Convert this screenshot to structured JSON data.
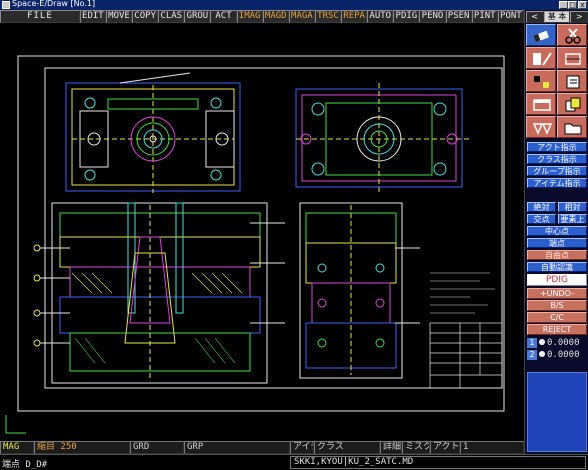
{
  "window": {
    "title": "Space-E/Draw [No.1]",
    "minimize": "_",
    "maximize": "□",
    "close": "x"
  },
  "menu": {
    "file": "FILE",
    "items": [
      {
        "label": "EDIT",
        "highlight": false
      },
      {
        "label": "MOVE",
        "highlight": false
      },
      {
        "label": "COPY",
        "highlight": false
      },
      {
        "label": "CLAS",
        "highlight": false
      },
      {
        "label": "GROU",
        "highlight": false
      },
      {
        "label": "ACT",
        "highlight": false
      },
      {
        "label": "IMAG",
        "highlight": true
      },
      {
        "label": "MAGD",
        "highlight": true
      },
      {
        "label": "MAGA",
        "highlight": true
      },
      {
        "label": "TRSC",
        "highlight": true
      },
      {
        "label": "REPA",
        "highlight": true
      },
      {
        "label": "AUTO",
        "highlight": false
      },
      {
        "label": "PDIG",
        "highlight": false
      },
      {
        "label": "PENO",
        "highlight": false
      },
      {
        "label": "PSEN",
        "highlight": false
      },
      {
        "label": "PINT",
        "highlight": false
      },
      {
        "label": "PONT",
        "highlight": false
      }
    ]
  },
  "panel": {
    "nav_prev": "<",
    "nav_label": "基 本",
    "nav_next": ">",
    "tools": [
      {
        "name": "eraser-icon",
        "selected": true
      },
      {
        "name": "scissors-icon",
        "selected": false
      },
      {
        "name": "erase-element-icon",
        "selected": false
      },
      {
        "name": "trim-icon",
        "selected": false
      },
      {
        "name": "corner-icon",
        "selected": false
      },
      {
        "name": "notebook-icon",
        "selected": false
      },
      {
        "name": "window-icon",
        "selected": false
      },
      {
        "name": "page-copy-icon",
        "selected": false
      },
      {
        "name": "shapes-icon",
        "selected": false
      },
      {
        "name": "folder-icon",
        "selected": false
      }
    ],
    "buttons": [
      {
        "label": "アクト指示",
        "style": "blue"
      },
      {
        "label": "クラス指示",
        "style": "blue"
      },
      {
        "label": "グループ指示",
        "style": "blue"
      },
      {
        "label": "アイテム指示",
        "style": "blue"
      }
    ],
    "pair1": {
      "left": "絶対",
      "right": "相対"
    },
    "pair2": {
      "left": "交点",
      "right": "要素上"
    },
    "center_point": "中心点",
    "end_point": "端点",
    "opt1": "自由点",
    "opt2": "自動認識",
    "pdig": "PDIG",
    "undo": "+UNDO-",
    "bs": "B/S",
    "cc": "C/C",
    "reject": "REJECT",
    "coords": [
      {
        "n": "1",
        "value": "0.0000"
      },
      {
        "n": "2",
        "value": "0.0000"
      }
    ]
  },
  "status": {
    "mag": "MAG",
    "scale": "縮目 250",
    "grd": "GRD",
    "grp": "GRP",
    "item": "アイテム",
    "class": "クラス",
    "detail": "詳細",
    "misc": "ミスク",
    "act": "アクト",
    "end": "1",
    "mode_line": "端点 D_D#",
    "file_name": "SKKI,KYOU|KU_2_SATC.MD"
  },
  "colors": {
    "titlebar": "#0a246a",
    "panel_blue": "#2a5fd0",
    "panel_red": "#c8705e",
    "drawing_white": "#e8e8e8",
    "drawing_yellow": "#e8e840",
    "drawing_green": "#40e040",
    "drawing_cyan": "#40e0e0",
    "drawing_magenta": "#e040e0",
    "drawing_blue": "#4060ff"
  }
}
